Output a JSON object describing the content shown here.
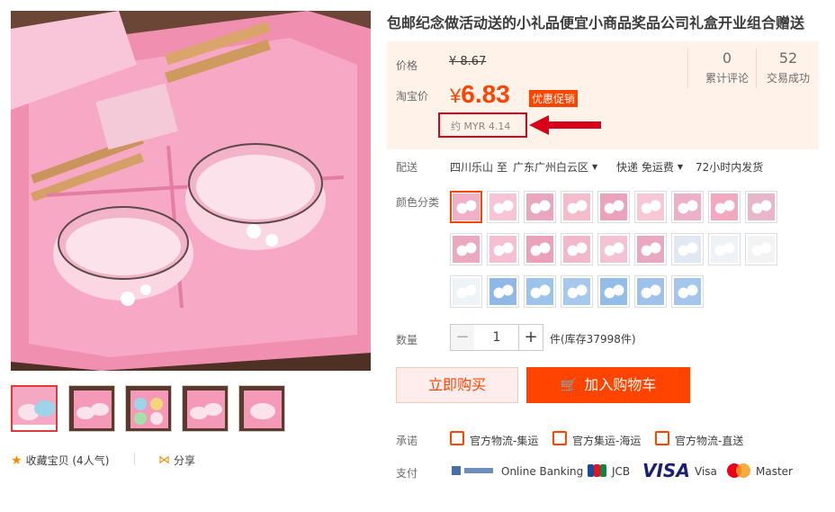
{
  "product": {
    "title": "包邮纪念做活动送的小礼品便宜小商品奖品公司礼盒开业组合赠送"
  },
  "price": {
    "label_price": "价格",
    "original": "¥ 8.67",
    "label_taobao": "淘宝价",
    "current_symbol": "¥",
    "current": "6.83",
    "promo_badge": "优惠促销",
    "myr": "约 MYR 4.14"
  },
  "stats": {
    "reviews_count": "0",
    "reviews_label": "累计评论",
    "sales_count": "52",
    "sales_label": "交易成功"
  },
  "delivery": {
    "label": "配送",
    "from": "四川乐山 至",
    "to": "广东广州白云区",
    "method": "快递 免运费",
    "time": "72小时内发货"
  },
  "sku": {
    "label": "颜色分类",
    "count": 25
  },
  "quantity": {
    "label": "数量",
    "value": "1",
    "minus": "−",
    "plus": "+",
    "stock": "件(库存37998件)"
  },
  "actions": {
    "buy_now": "立即购买",
    "add_cart": "加入购物车"
  },
  "promise": {
    "label": "承诺",
    "items": [
      "官方物流-集运",
      "官方集运-海运",
      "官方物流-直送"
    ]
  },
  "payment": {
    "label": "支付",
    "items": [
      "Online Banking",
      "JCB",
      "VISA",
      "Visa",
      "Master"
    ]
  },
  "social": {
    "favorite": "收藏宝贝 (4人气)",
    "share": "分享"
  },
  "colors": {
    "accent": "#ff4400",
    "price_bg": "#fff2e8",
    "highlight": "#d9001b"
  }
}
